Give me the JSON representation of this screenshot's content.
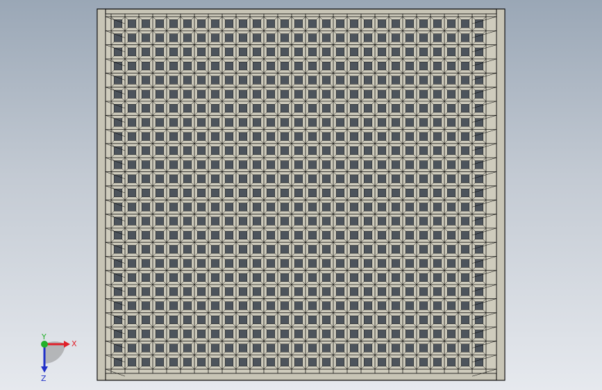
{
  "viewport": {
    "background_top": "#9aa7b6",
    "background_bottom": "#e6e9ee"
  },
  "model": {
    "name": "perforated-grid-plate",
    "frame_color": "#c8c5b6",
    "edge_color": "#000000",
    "hole_color": "#4d545c",
    "columns": 27,
    "rows": 25
  },
  "triad": {
    "x_label": "X",
    "y_label": "Y",
    "z_label": "Z",
    "x_color": "#e0202a",
    "y_color": "#22b02a",
    "z_color": "#2030c8"
  }
}
